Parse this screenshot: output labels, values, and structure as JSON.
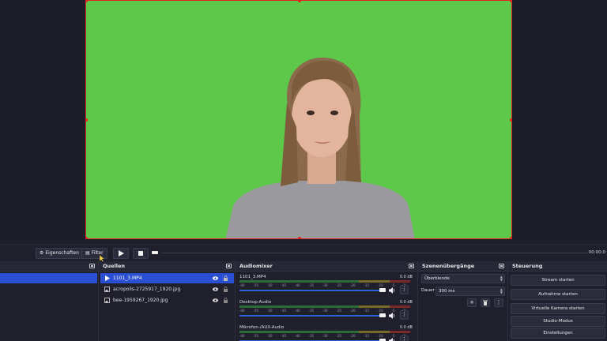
{
  "toolbar": {
    "properties_label": "Eigenschaften",
    "filter_label": "Filter",
    "time": "00:00:0"
  },
  "sources": {
    "title": "Quellen",
    "items": [
      {
        "name": "1101_3.MP4",
        "type": "media"
      },
      {
        "name": "acropolis-2725917_1920.jpg",
        "type": "image"
      },
      {
        "name": "bee-1959267_1920.jpg",
        "type": "image"
      }
    ]
  },
  "mixer": {
    "title": "Audiomixer",
    "scale": [
      "-60",
      "-55",
      "-50",
      "-45",
      "-40",
      "-35",
      "-30",
      "-25",
      "-20",
      "-15",
      "-10",
      "-5",
      "0"
    ],
    "channels": [
      {
        "name": "1101_3.MP4",
        "db": "0.0 dB"
      },
      {
        "name": "Desktop-Audio",
        "db": "0.0 dB"
      },
      {
        "name": "Mikrofon-/AUX-Audio",
        "db": "0.0 dB"
      }
    ]
  },
  "transitions": {
    "title": "Szenenübergänge",
    "selected": "Überblende",
    "duration_label": "Dauer",
    "duration_value": "300 ms"
  },
  "controls": {
    "title": "Steuerung",
    "buttons": [
      "Stream starten",
      "Aufnahme starten",
      "Virtuelle Kamera starten",
      "Studio-Modus",
      "Einstellungen"
    ]
  },
  "colors": {
    "accent": "#2b4fd2",
    "chroma_green": "#5ec84a",
    "selection_border": "#e0241f"
  }
}
